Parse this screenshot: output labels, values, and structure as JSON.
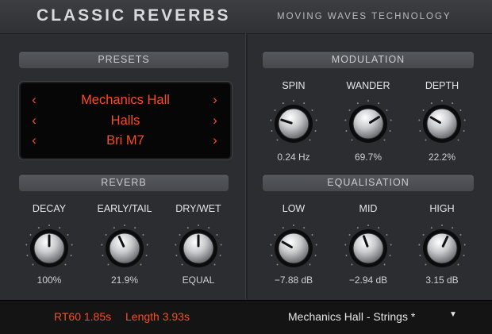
{
  "header": {
    "title": "CLASSIC REVERBS",
    "company": "MOVING WAVES TECHNOLOGY"
  },
  "presets": {
    "header": "PRESETS",
    "rows": [
      {
        "value": "Mechanics Hall"
      },
      {
        "value": "Halls"
      },
      {
        "value": "Bri M7"
      }
    ],
    "arrow_left_icon": "chevron-left-icon",
    "arrow_right_icon": "chevron-right-icon"
  },
  "reverb": {
    "header": "REVERB",
    "knobs": [
      {
        "label": "DECAY",
        "value": "100%",
        "angle": 0
      },
      {
        "label": "EARLY/TAIL",
        "value": "21.9%",
        "angle": -25
      },
      {
        "label": "DRY/WET",
        "value": "EQUAL",
        "angle": 0
      }
    ]
  },
  "modulation": {
    "header": "MODULATION",
    "knobs": [
      {
        "label": "SPIN",
        "value": "0.24 Hz",
        "angle": -72
      },
      {
        "label": "WANDER",
        "value": "69.7%",
        "angle": 58
      },
      {
        "label": "DEPTH",
        "value": "22.2%",
        "angle": -60
      }
    ]
  },
  "equalisation": {
    "header": "EQUALISATION",
    "knobs": [
      {
        "label": "LOW",
        "value": "−7.88 dB",
        "angle": -60
      },
      {
        "label": "MID",
        "value": "−2.94 dB",
        "angle": -20
      },
      {
        "label": "HIGH",
        "value": "3.15 dB",
        "angle": 25
      }
    ]
  },
  "footer": {
    "rt60": "RT60 1.85s",
    "length": "Length 3.93s",
    "preset_name": "Mechanics Hall - Strings *",
    "dropdown_icon": "triangle-down-icon"
  },
  "colors": {
    "lcd_text": "#ff4a1e",
    "background": "#2b2d30"
  }
}
